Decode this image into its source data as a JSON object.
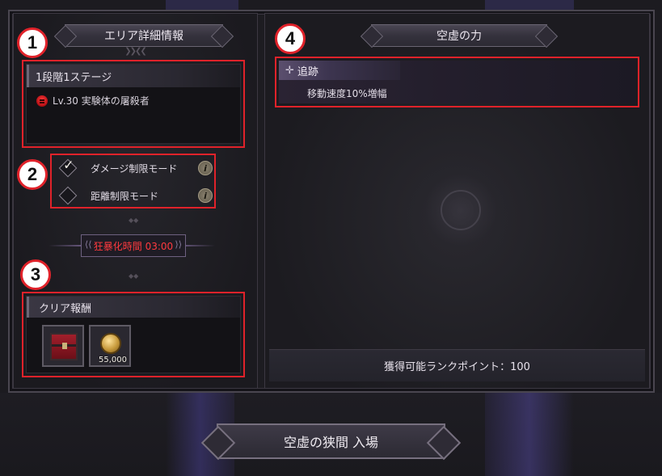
{
  "left_header": "エリア詳細情報",
  "right_header": "空虚の力",
  "stage": {
    "title": "1段階1ステージ",
    "boss": "Lv.30 実験体の屠殺者"
  },
  "modes": [
    {
      "label": "ダメージ制限モード",
      "checked": true
    },
    {
      "label": "距離制限モード",
      "checked": false
    }
  ],
  "info_glyph": "i",
  "berserk": "狂暴化時間 03:00",
  "reward": {
    "title": "クリア報酬",
    "items": [
      {
        "icon": "treasure-chest-icon",
        "count": ""
      },
      {
        "icon": "gold-coin-icon",
        "count": "55,000"
      }
    ]
  },
  "buff": {
    "name": "追跡",
    "description": "移動速度10%増幅"
  },
  "rank_points": "獲得可能ランクポイント：100",
  "enter_button": "空虚の狭間 入場",
  "markers": [
    "1",
    "2",
    "3",
    "4"
  ]
}
